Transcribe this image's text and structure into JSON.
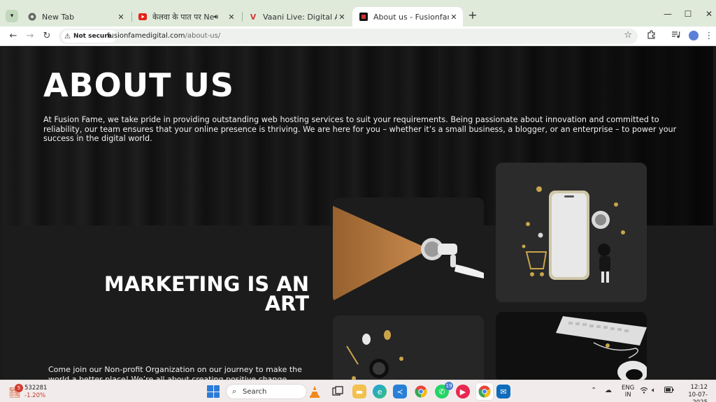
{
  "browser": {
    "tabs": [
      {
        "label": "New Tab",
        "favicon": "chrome-icon"
      },
      {
        "label": "केलवा के पात पर New Version",
        "favicon": "youtube-icon",
        "audio": true
      },
      {
        "label": "Vaani Live: Digital Agency, Web",
        "favicon": "vaani-icon"
      },
      {
        "label": "About us - Fusionfame Digital",
        "favicon": "fusionfame-icon",
        "active": true
      }
    ],
    "address": {
      "security_label": "Not secure",
      "domain": "fusionfamedigital.com",
      "path": "/about-us/"
    }
  },
  "page": {
    "about_title": "ABOUT US",
    "about_text": "At Fusion Fame, we take pride in providing outstanding web hosting services to suit your requirements. Being passionate about innovation and committed to reliability, our team ensures that your online presence is thriving. We are here for you – whether it’s a small business, a blogger, or an enterprise – to power your success in the digital world.",
    "marketing_title_line1": "MARKETING IS AN",
    "marketing_title_line2": "ART",
    "marketing_text": "Come join our Non-profit Organization on our journey to make the world a better place! We’re all about creating positive change through"
  },
  "taskbar": {
    "stock_value": "532281",
    "stock_change": "-1.20%",
    "stock_badge": "5",
    "search_label": "Search",
    "whatsapp_badge": "19",
    "lang_line1": "ENG",
    "lang_line2": "IN",
    "time": "12:12",
    "date": "10-07-2025"
  },
  "colors": {
    "tabstrip": "#dfeadb",
    "accent_youtube": "#e62117",
    "accent_vaani": "#d63a3a",
    "stock_negative": "#c43a2c"
  }
}
